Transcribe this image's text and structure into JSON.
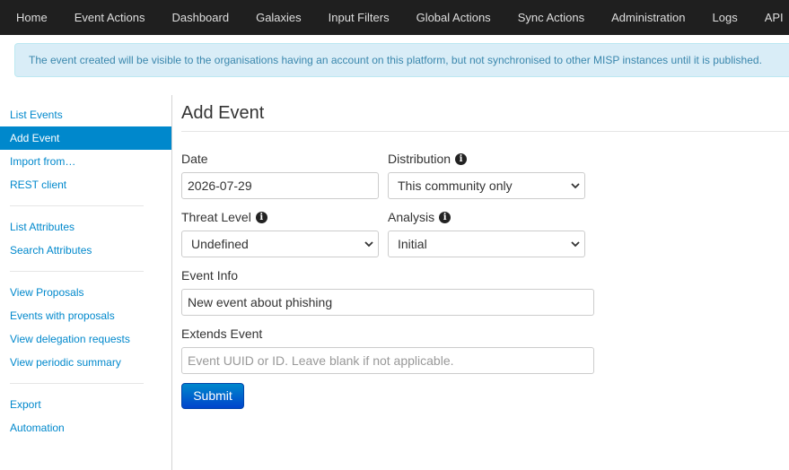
{
  "navbar": {
    "items": [
      {
        "label": "Home"
      },
      {
        "label": "Event Actions"
      },
      {
        "label": "Dashboard"
      },
      {
        "label": "Galaxies"
      },
      {
        "label": "Input Filters"
      },
      {
        "label": "Global Actions"
      },
      {
        "label": "Sync Actions"
      },
      {
        "label": "Administration"
      },
      {
        "label": "Logs"
      },
      {
        "label": "API"
      }
    ]
  },
  "alert": {
    "text": "The event created will be visible to the organisations having an account on this platform, but not synchronised to other MISP instances until it is published."
  },
  "sidebar": {
    "groups": [
      [
        {
          "label": "List Events",
          "active": false
        },
        {
          "label": "Add Event",
          "active": true
        },
        {
          "label": "Import from…",
          "active": false
        },
        {
          "label": "REST client",
          "active": false
        }
      ],
      [
        {
          "label": "List Attributes",
          "active": false
        },
        {
          "label": "Search Attributes",
          "active": false
        }
      ],
      [
        {
          "label": "View Proposals",
          "active": false
        },
        {
          "label": "Events with proposals",
          "active": false
        },
        {
          "label": "View delegation requests",
          "active": false
        },
        {
          "label": "View periodic summary",
          "active": false
        }
      ],
      [
        {
          "label": "Export",
          "active": false
        },
        {
          "label": "Automation",
          "active": false
        }
      ]
    ]
  },
  "form": {
    "title": "Add Event",
    "date": {
      "label": "Date",
      "value": "2026-07-29"
    },
    "distribution": {
      "label": "Distribution",
      "value": "This community only",
      "icon": "info-icon"
    },
    "threat_level": {
      "label": "Threat Level",
      "value": "Undefined",
      "icon": "info-icon"
    },
    "analysis": {
      "label": "Analysis",
      "value": "Initial",
      "icon": "info-icon"
    },
    "event_info": {
      "label": "Event Info",
      "value": "New event about phishing"
    },
    "extends_event": {
      "label": "Extends Event",
      "placeholder": "Event UUID or ID. Leave blank if not applicable.",
      "value": ""
    },
    "submit_label": "Submit"
  },
  "colors": {
    "navbar_bg": "#1f1f1f",
    "link": "#0088cc",
    "active_bg": "#0088cc",
    "alert_bg": "#d9edf7",
    "alert_text": "#3a87ad"
  }
}
